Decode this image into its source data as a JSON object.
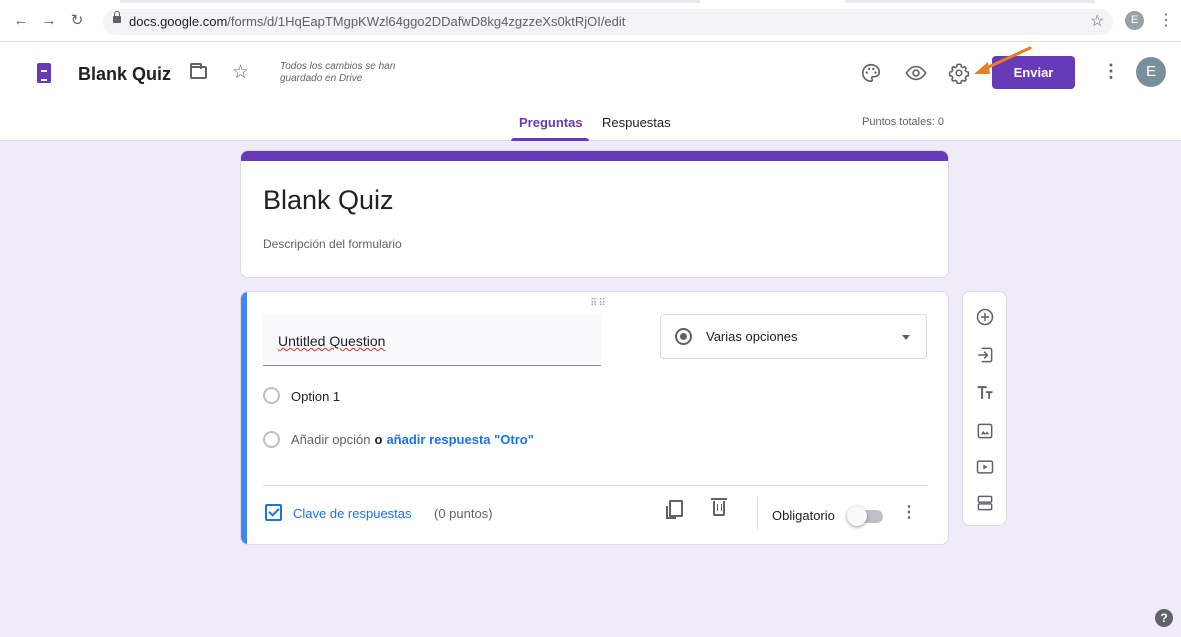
{
  "browser": {
    "url_host": "docs.google.com",
    "url_path": "/forms/d/1HqEapTMgpKWzl64ggo2DDafwD8kg4zgzzeXs0ktRjOI/edit",
    "profile_initial": "E"
  },
  "header": {
    "doc_title": "Blank Quiz",
    "save_status": "Todos los cambios se han guardado en Drive",
    "send_label": "Enviar",
    "avatar_initial": "E",
    "accent_color": "#673ab7"
  },
  "tabs": {
    "questions": "Preguntas",
    "responses": "Respuestas",
    "points_total": "Puntos totales: 0"
  },
  "form": {
    "title": "Blank Quiz",
    "description_placeholder": "Descripción del formulario"
  },
  "question": {
    "title": "Untitled Question",
    "type": "Varias opciones",
    "options": [
      "Option 1"
    ],
    "add_option": "Añadir opción",
    "separator": "o",
    "add_other": "añadir respuesta \"Otro\"",
    "answer_key": "Clave de respuestas",
    "points": "(0 puntos)",
    "required_label": "Obligatorio",
    "required": false
  },
  "icons": {
    "side_toolbar": [
      "add-question-icon",
      "import-questions-icon",
      "add-title-icon",
      "add-image-icon",
      "add-video-icon",
      "add-section-icon"
    ],
    "header": [
      "palette-icon",
      "preview-icon",
      "settings-icon"
    ]
  },
  "annotation_color": "#e67e22"
}
